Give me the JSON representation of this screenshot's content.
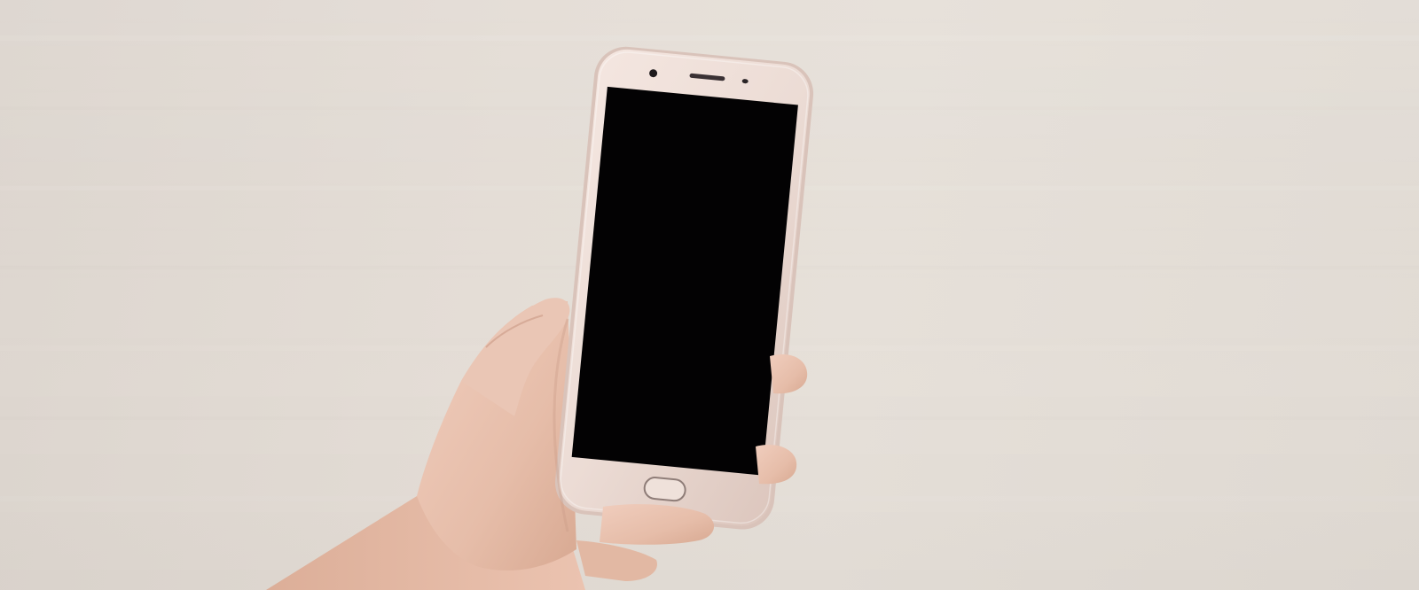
{
  "scene": {
    "colors": {
      "background": "#e3dcd5",
      "phone_body": "#ead9d2",
      "phone_bezel": "#f1e3dd",
      "screen": "#030203",
      "skin": "#e9c4b2",
      "skin_shadow": "#c99a86"
    },
    "phone": {
      "screen_state": "off",
      "home_button": "oval"
    },
    "icons": [
      "front-camera-icon",
      "earpiece-icon",
      "sensor-icon",
      "home-button-icon"
    ]
  }
}
